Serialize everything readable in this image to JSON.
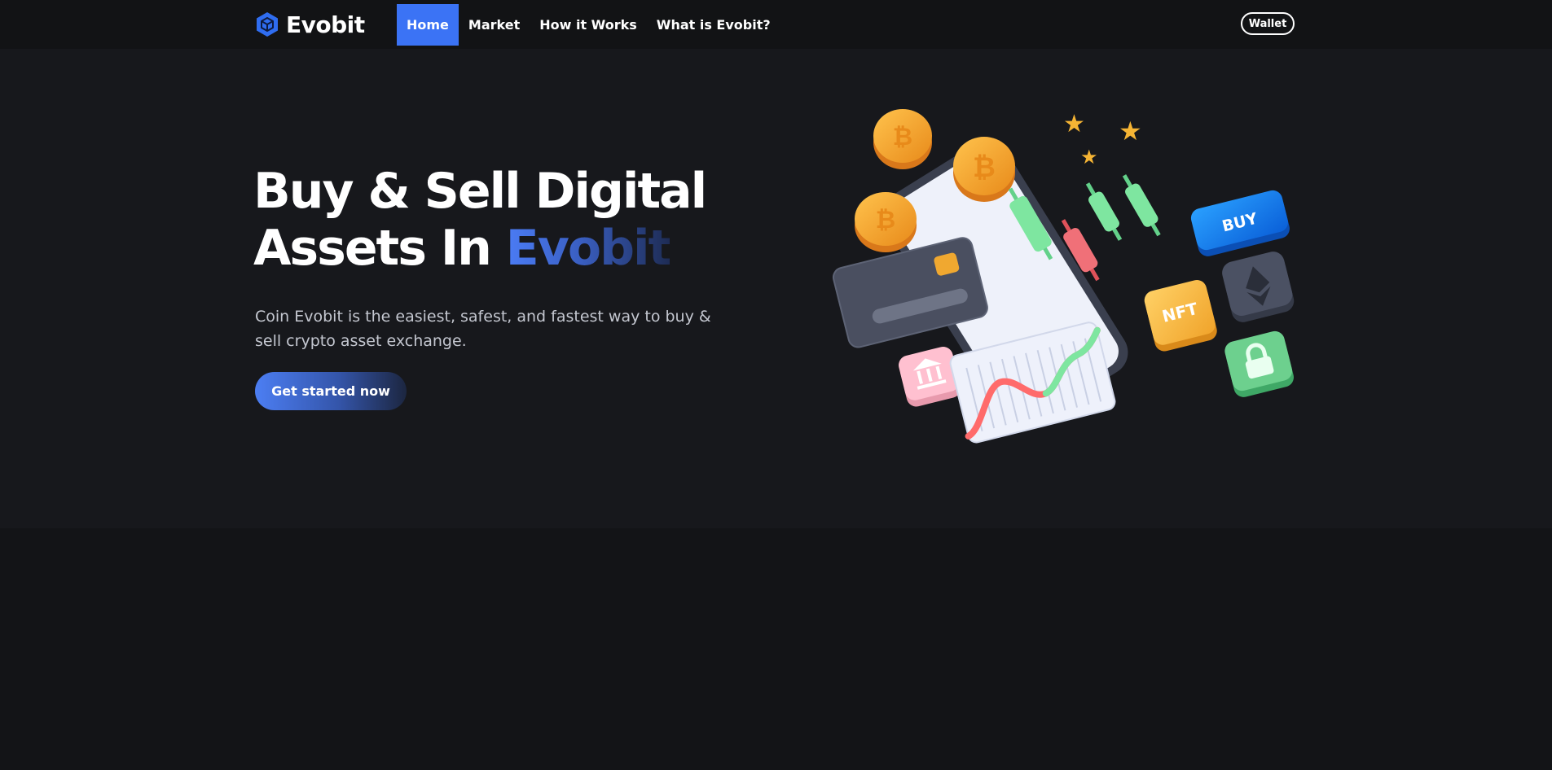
{
  "header": {
    "brand": "Evobit",
    "nav": [
      {
        "label": "Home",
        "active": true
      },
      {
        "label": "Market",
        "active": false
      },
      {
        "label": "How it Works",
        "active": false
      },
      {
        "label": "What is Evobit?",
        "active": false
      }
    ],
    "wallet_label": "Wallet"
  },
  "hero": {
    "title_line1": "Buy & Sell Digital",
    "title_line2_prefix": "Assets In ",
    "title_line2_accent": "Evobit",
    "description": "Coin Evobit is the easiest, safest, and fastest way to buy & sell crypto asset exchange.",
    "cta_label": "Get started now"
  },
  "illustration": {
    "buy_tile": "BUY",
    "nft_tile": "NFT",
    "icons": [
      "bitcoin-coin-icon",
      "ethereum-icon",
      "lock-icon",
      "bank-icon",
      "credit-card-icon",
      "star-icon",
      "smartphone-icon",
      "candlestick-chart-icon",
      "line-chart-icon"
    ]
  },
  "colors": {
    "background": "#131417",
    "hero_background": "#17181c",
    "accent": "#3b73f5",
    "text_muted": "#c4c7d0"
  }
}
